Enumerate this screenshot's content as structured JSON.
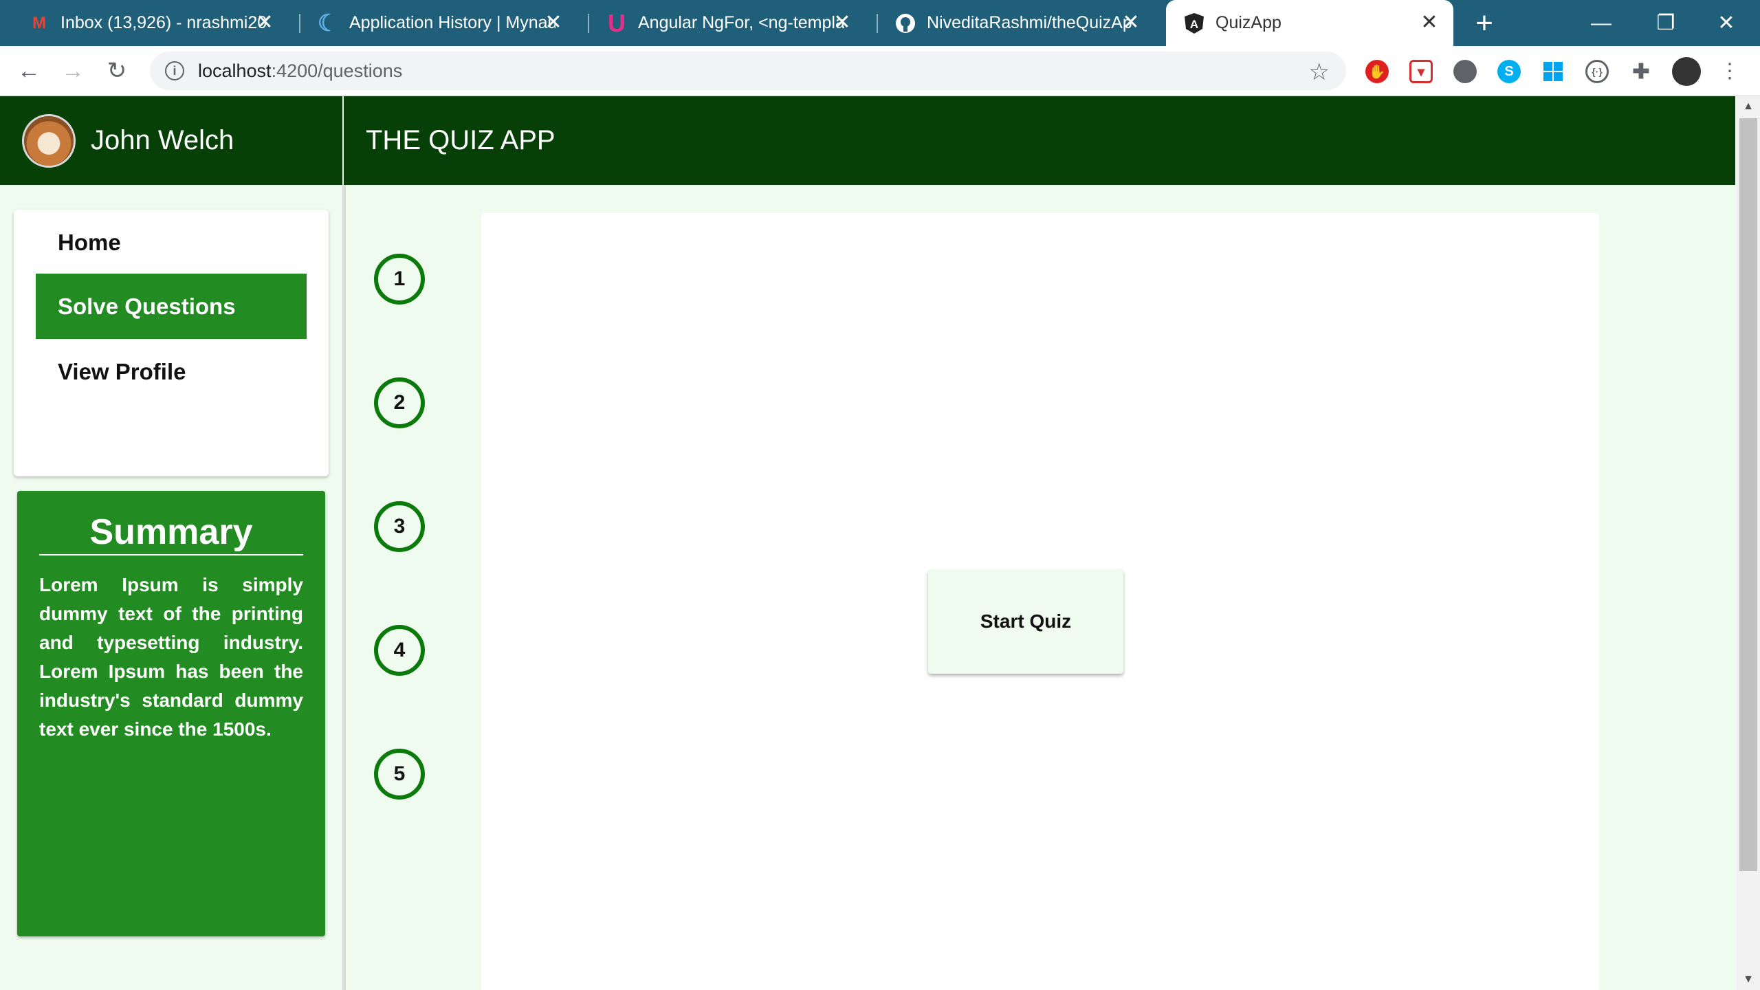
{
  "browser": {
    "tabs": [
      {
        "title": "Inbox (13,926) - nrashmi20(",
        "icon": "gmail-icon"
      },
      {
        "title": "Application History | Mynau",
        "icon": "mynaukri-icon"
      },
      {
        "title": "Angular NgFor, <ng-templa",
        "icon": "ultimate-courses-icon"
      },
      {
        "title": "NiveditaRashmi/theQuizAp",
        "icon": "github-icon"
      },
      {
        "title": "QuizApp",
        "icon": "angular-icon"
      }
    ],
    "new_tab": "+",
    "close": "✕",
    "url_host": "localhost",
    "url_path": ":4200/questions"
  },
  "app": {
    "user_name": "John Welch",
    "title": "THE QUIZ APP",
    "menu": [
      {
        "label": "Home",
        "active": false
      },
      {
        "label": "Solve Questions",
        "active": true
      },
      {
        "label": "View Profile",
        "active": false
      }
    ],
    "summary_title": "Summary",
    "summary_text": "Lorem Ipsum is simply dummy text of the printing and typesetting industry. Lorem Ipsum has been the industry's standard dummy text ever since the 1500s.",
    "questions": [
      "1",
      "2",
      "3",
      "4",
      "5"
    ],
    "start_button": "Start Quiz"
  },
  "colors": {
    "header": "#064006",
    "accent": "#228b22",
    "background": "#effbee",
    "tabstrip": "#1f5f7a"
  }
}
